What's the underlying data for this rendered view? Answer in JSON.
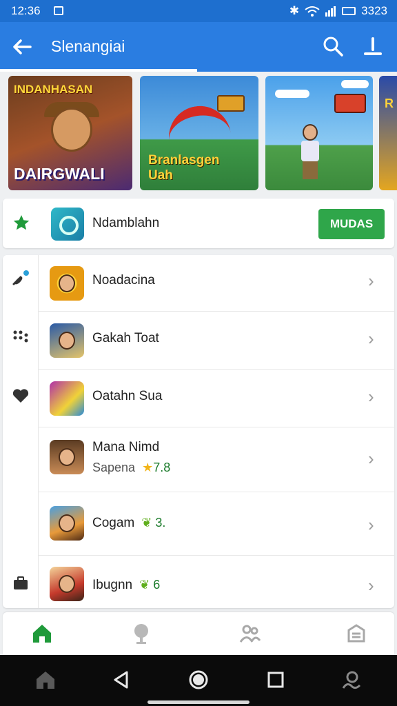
{
  "status_bar": {
    "time": "12:36",
    "right_text": "3323"
  },
  "app_bar": {
    "title": "Slenangiai",
    "back_icon": "arrow-left-icon",
    "search_icon": "search-icon",
    "download_icon": "download-icon"
  },
  "banners": [
    {
      "top_text": "INDANHASAN",
      "bottom_text": "DAIRGWALI"
    },
    {
      "text_line1": "Branlasgen",
      "text_line2": "Uah"
    },
    {
      "text": ""
    },
    {
      "text": "R"
    }
  ],
  "featured": {
    "name": "Ndamblahn",
    "install_label": "MUDAS",
    "rail_icon": "star-icon"
  },
  "rail_icons": [
    "satellite-icon",
    "dots-icon",
    "heart-icon",
    "briefcase-icon"
  ],
  "list": [
    {
      "name": "Noadacina"
    },
    {
      "name": "Gakah Toat"
    },
    {
      "name": "Oatahn Sua"
    },
    {
      "name": "Mana Nimd",
      "sub": "Sapena",
      "rating": "7.8"
    },
    {
      "name": "Cogam",
      "rating": "3."
    },
    {
      "name": "Ibugnn",
      "rating": "6"
    }
  ],
  "bottom_nav": [
    "home-icon",
    "podcast-icon",
    "people-icon",
    "bank-icon"
  ],
  "colors": {
    "primary": "#2a7de1",
    "status": "#1e6fcf",
    "install_green": "#2fa64a",
    "active_nav": "#1f9a3a"
  }
}
